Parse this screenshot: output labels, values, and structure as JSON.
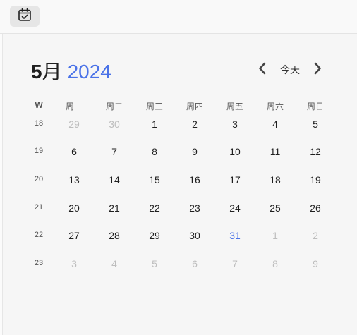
{
  "header": {
    "month_num": "5",
    "month_suffix": "月",
    "year": "2024",
    "today_label": "今天"
  },
  "icons": {
    "calendar": "calendar-check-icon",
    "prev": "chevron-left-icon",
    "next": "chevron-right-icon"
  },
  "colors": {
    "accent": "#4a72e8",
    "muted": "#bdbdbd",
    "text": "#1f1f1f"
  },
  "weekdays": {
    "week_col": "W",
    "days": [
      "周一",
      "周二",
      "周三",
      "周四",
      "周五",
      "周六",
      "周日"
    ]
  },
  "weeks": [
    {
      "num": "18",
      "days": [
        {
          "d": "29",
          "m": true
        },
        {
          "d": "30",
          "m": true
        },
        {
          "d": "1"
        },
        {
          "d": "2"
        },
        {
          "d": "3"
        },
        {
          "d": "4"
        },
        {
          "d": "5"
        }
      ]
    },
    {
      "num": "19",
      "days": [
        {
          "d": "6"
        },
        {
          "d": "7"
        },
        {
          "d": "8"
        },
        {
          "d": "9"
        },
        {
          "d": "10"
        },
        {
          "d": "11"
        },
        {
          "d": "12"
        }
      ]
    },
    {
      "num": "20",
      "days": [
        {
          "d": "13"
        },
        {
          "d": "14"
        },
        {
          "d": "15"
        },
        {
          "d": "16"
        },
        {
          "d": "17"
        },
        {
          "d": "18"
        },
        {
          "d": "19"
        }
      ]
    },
    {
      "num": "21",
      "days": [
        {
          "d": "20"
        },
        {
          "d": "21"
        },
        {
          "d": "22"
        },
        {
          "d": "23"
        },
        {
          "d": "24"
        },
        {
          "d": "25"
        },
        {
          "d": "26"
        }
      ]
    },
    {
      "num": "22",
      "days": [
        {
          "d": "27"
        },
        {
          "d": "28"
        },
        {
          "d": "29"
        },
        {
          "d": "30"
        },
        {
          "d": "31",
          "t": true
        },
        {
          "d": "1",
          "m": true
        },
        {
          "d": "2",
          "m": true
        }
      ]
    },
    {
      "num": "23",
      "days": [
        {
          "d": "3",
          "m": true
        },
        {
          "d": "4",
          "m": true
        },
        {
          "d": "5",
          "m": true
        },
        {
          "d": "6",
          "m": true
        },
        {
          "d": "7",
          "m": true
        },
        {
          "d": "8",
          "m": true
        },
        {
          "d": "9",
          "m": true
        }
      ]
    }
  ]
}
